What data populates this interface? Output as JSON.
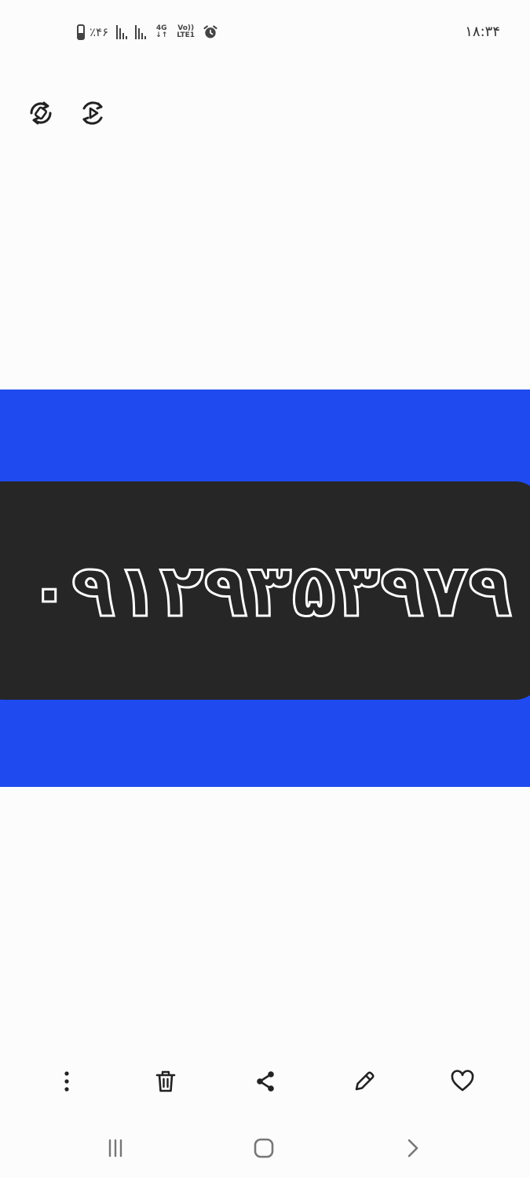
{
  "status_bar": {
    "battery_text": "٪۴۶",
    "network_top": "4G",
    "network_bottom": "↓↑",
    "volte_top": "Vo))",
    "volte_bottom": "LTE1",
    "time": "۱۸:۳۴"
  },
  "toolbar": {
    "icons": [
      "rotate-icon",
      "motion-photo-icon"
    ]
  },
  "image": {
    "phone_number": "۰۹۱۲۹۳۵۳۹۷۹",
    "background_color": "#1f4af0",
    "plate_color": "#262626"
  },
  "actions": {
    "icons": [
      "more-options-icon",
      "trash-icon",
      "share-icon",
      "edit-icon",
      "favorite-heart-icon"
    ]
  },
  "navigation": {
    "icons": [
      "recent-apps-icon",
      "home-icon",
      "back-icon"
    ]
  }
}
